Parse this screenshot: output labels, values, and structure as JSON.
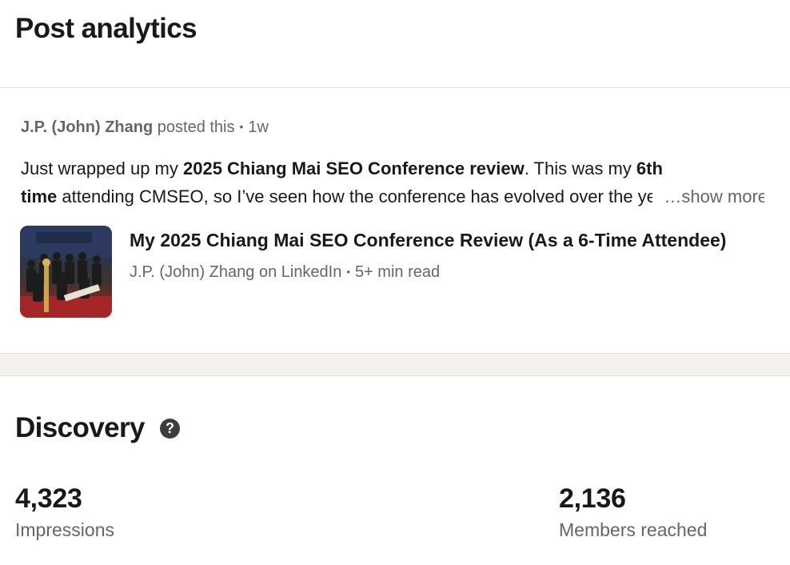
{
  "header": {
    "title": "Post analytics"
  },
  "post": {
    "author": "J.P. (John) Zhang",
    "action": "posted this",
    "time": "1w",
    "text_line1": {
      "pre": "Just wrapped up my ",
      "bold1": "2025 Chiang Mai SEO Conference review",
      "mid": ". This was my ",
      "bold2": "6th"
    },
    "text_line2": {
      "bold": "time",
      "rest": " attending CMSEO, so I’ve seen how the conference has evolved over the years"
    },
    "show_more": "…show more",
    "article": {
      "title": "My 2025 Chiang Mai SEO Conference Review (As a 6-Time Attendee)",
      "source": "J.P. (John) Zhang on LinkedIn",
      "read_time": "5+ min read"
    }
  },
  "discovery": {
    "title": "Discovery",
    "help_icon": "question-circle-icon",
    "metrics": [
      {
        "value": "4,323",
        "label": "Impressions"
      },
      {
        "value": "2,136",
        "label": "Members reached"
      }
    ]
  }
}
